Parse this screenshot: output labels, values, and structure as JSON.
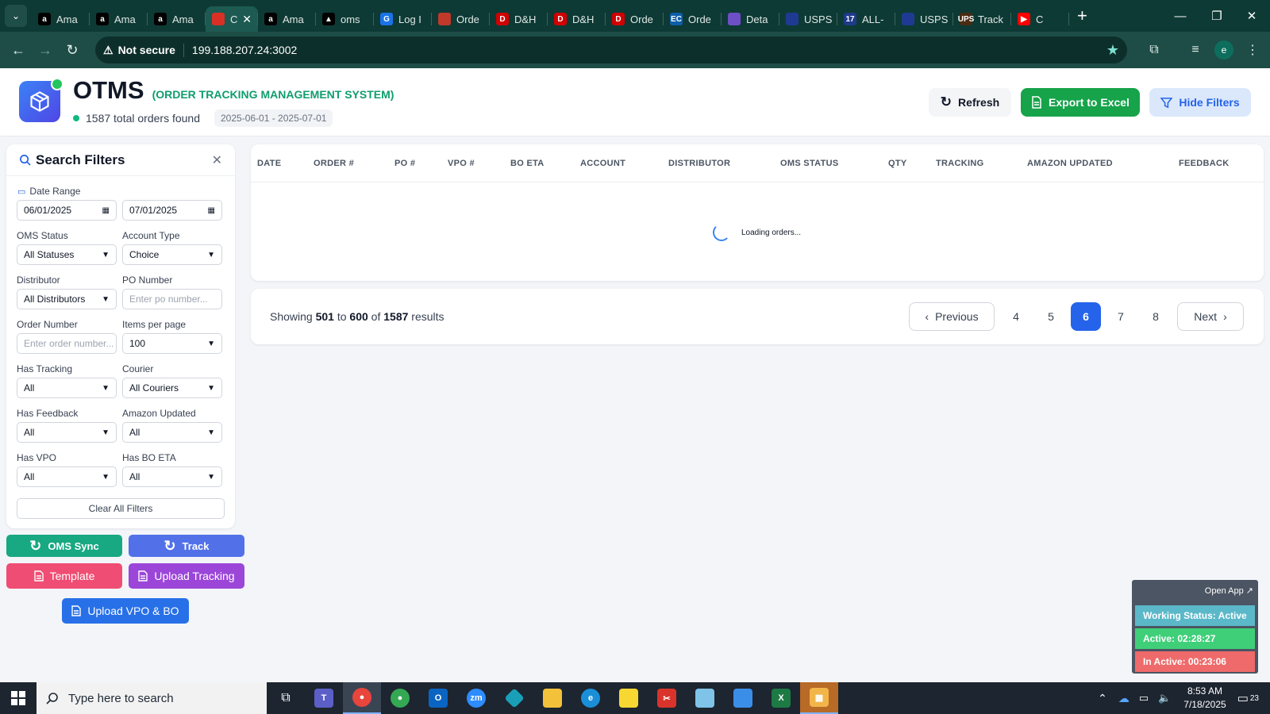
{
  "browser": {
    "tabs": [
      {
        "label": "Ama",
        "fav": "a",
        "color": "#000000"
      },
      {
        "label": "Ama",
        "fav": "a",
        "color": "#000000"
      },
      {
        "label": "Ama",
        "fav": "a",
        "color": "#000000"
      },
      {
        "label": "C",
        "fav": "",
        "color": "#d93025",
        "active": true
      },
      {
        "label": "Ama",
        "fav": "a",
        "color": "#000000"
      },
      {
        "label": "oms",
        "fav": "▲",
        "color": "#000000"
      },
      {
        "label": "Log I",
        "fav": "G",
        "color": "#1a73e8"
      },
      {
        "label": "Orde",
        "fav": "",
        "color": "#c0392b"
      },
      {
        "label": "D&H",
        "fav": "D",
        "color": "#d00000"
      },
      {
        "label": "D&H",
        "fav": "D",
        "color": "#d00000"
      },
      {
        "label": "Orde",
        "fav": "D",
        "color": "#d00000"
      },
      {
        "label": "Orde",
        "fav": "EC",
        "color": "#0e5ea8"
      },
      {
        "label": "Deta",
        "fav": "",
        "color": "#6d4fc7"
      },
      {
        "label": "USPS",
        "fav": "",
        "color": "#1f3a93"
      },
      {
        "label": "ALL-",
        "fav": "17",
        "color": "#1e3a8a"
      },
      {
        "label": "USPS",
        "fav": "",
        "color": "#1f3a93"
      },
      {
        "label": "Track",
        "fav": "UPS",
        "color": "#4a2c13"
      },
      {
        "label": "C",
        "fav": "▶",
        "color": "#ff0000"
      }
    ],
    "url": "199.188.207.24:3002",
    "security_label": "Not secure",
    "profile_initial": "e"
  },
  "header": {
    "app_name": "OTMS",
    "app_subtitle": "(ORDER TRACKING MANAGEMENT SYSTEM)",
    "orders_found": "1587 total orders found",
    "date_range_chip": "2025-06-01 - 2025-07-01",
    "refresh_label": "Refresh",
    "export_label": "Export to Excel",
    "hide_filters_label": "Hide Filters"
  },
  "filters": {
    "title": "Search Filters",
    "date_range_label": "Date Range",
    "date_from": "06/01/2025",
    "date_to": "07/01/2025",
    "oms_status_label": "OMS Status",
    "oms_status_value": "All Statuses",
    "account_type_label": "Account Type",
    "account_type_value": "Choice",
    "distributor_label": "Distributor",
    "distributor_value": "All Distributors",
    "po_number_label": "PO Number",
    "po_number_placeholder": "Enter po number...",
    "order_number_label": "Order Number",
    "order_number_placeholder": "Enter order number...",
    "items_per_page_label": "Items per page",
    "items_per_page_value": "100",
    "has_tracking_label": "Has Tracking",
    "has_tracking_value": "All",
    "courier_label": "Courier",
    "courier_value": "All Couriers",
    "has_feedback_label": "Has Feedback",
    "has_feedback_value": "All",
    "amazon_updated_label": "Amazon Updated",
    "amazon_updated_value": "All",
    "has_vpo_label": "Has VPO",
    "has_vpo_value": "All",
    "has_bo_eta_label": "Has BO ETA",
    "has_bo_eta_value": "All",
    "clear_label": "Clear All Filters"
  },
  "actions": {
    "oms_sync": "OMS Sync",
    "track": "Track",
    "template": "Template",
    "upload_tracking": "Upload Tracking",
    "upload_vpo_bo": "Upload VPO & BO"
  },
  "table": {
    "columns": [
      "DATE",
      "ORDER #",
      "PO #",
      "VPO #",
      "BO ETA",
      "ACCOUNT",
      "DISTRIBUTOR",
      "OMS STATUS",
      "QTY",
      "TRACKING",
      "AMAZON UPDATED",
      "FEEDBACK"
    ],
    "loading_text": "Loading orders..."
  },
  "pagination": {
    "showing_prefix": "Showing",
    "from": "501",
    "to_word": "to",
    "to": "600",
    "of_word": "of",
    "total": "1587",
    "results_word": "results",
    "previous": "Previous",
    "next": "Next",
    "pages": [
      "4",
      "5",
      "6",
      "7",
      "8"
    ],
    "current_page": "6"
  },
  "work_status": {
    "open_app": "Open App ↗",
    "status": "Working Status: Active",
    "active": "Active: 02:28:27",
    "inactive": "In Active: 00:23:06"
  },
  "taskbar": {
    "search_placeholder": "Type here to search",
    "time": "8:53 AM",
    "date": "7/18/2025",
    "notifications": "23"
  },
  "colors": {
    "accent_green": "#16a34a",
    "accent_blue": "#2563eb",
    "browser_dark": "#0e3a35"
  }
}
